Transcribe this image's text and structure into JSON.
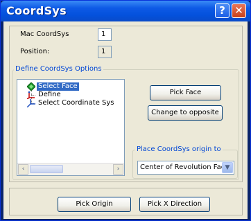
{
  "window": {
    "title": "CoordSys",
    "help_glyph": "?",
    "close_glyph": "✕"
  },
  "fields": {
    "mac_label": "Mac CoordSys",
    "mac_value": "1",
    "position_label": "Position:",
    "position_value": "1"
  },
  "options_group": {
    "label": "Define CoordSys Options"
  },
  "tree": {
    "items": [
      {
        "label": "Select Face",
        "icon": "green-face-icon",
        "selected": true
      },
      {
        "label": "Define",
        "icon": "axes-icon",
        "selected": false
      },
      {
        "label": "Select Coordinate Sys",
        "icon": "coordinate-system-icon",
        "selected": false
      }
    ]
  },
  "scroll": {
    "left_glyph": "‹",
    "right_glyph": "›"
  },
  "buttons": {
    "pick_face": "Pick Face",
    "change_to_opposite": "Change to opposite",
    "pick_origin": "Pick Origin",
    "pick_x_direction": "Pick X Direction"
  },
  "origin_group": {
    "label": "Place CoordSys origin to",
    "selected": "Center of Revolution Face",
    "arrow_glyph": "▼"
  }
}
